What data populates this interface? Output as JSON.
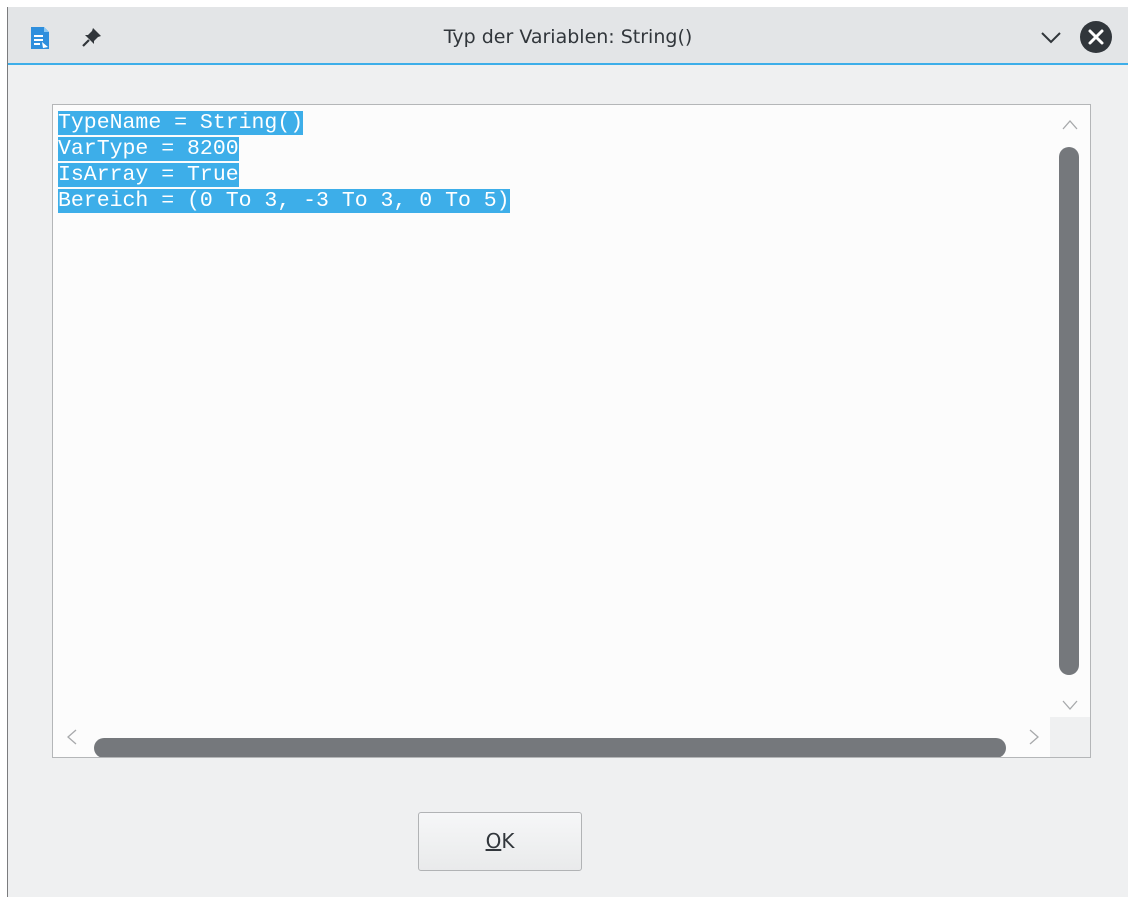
{
  "window": {
    "title": "Typ der Variablen: String()",
    "icons": {
      "app": "document-app-icon",
      "pin": "pin-icon",
      "minimize": "chevron-down-icon",
      "close": "close-icon"
    },
    "colors": {
      "accent": "#3daee9",
      "titlebar": "#e3e5e7",
      "background": "#eff0f1"
    }
  },
  "content": {
    "lines": [
      "TypeName = String()",
      "VarType = 8200",
      "IsArray = True",
      "Bereich = (0 To 3, -3 To 3, 0 To 5)"
    ],
    "selection_color": "#3daee9"
  },
  "buttons": {
    "ok_mnemonic": "O",
    "ok_rest": "K"
  }
}
